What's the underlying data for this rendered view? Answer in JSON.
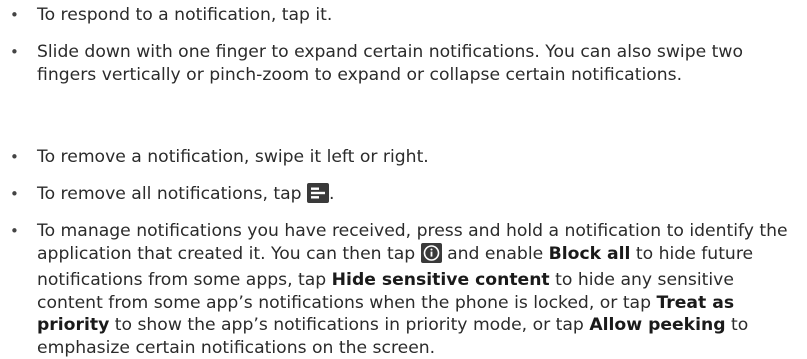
{
  "bullets": [
    {
      "text": "To respond to a notification, tap it."
    },
    {
      "text": "Slide down with one finger to expand certain notifications. You can also swipe two fingers vertically or pinch-zoom to expand or collapse certain notifications."
    },
    {
      "text": "To remove a notification, swipe it left or right."
    },
    {
      "before": "To remove all notifications, tap ",
      "icon": "clear-all-icon",
      "after": "."
    },
    {
      "p1": "To manage notifications you have received, press and hold a notification to identify the application that created it. You can then tap ",
      "icon": "info-icon",
      "p2": " and enable ",
      "b1": "Block all",
      "p3": " to hide future notifications from some apps, tap ",
      "b2": "Hide sensitive content",
      "p4": " to hide any sensitive content from some app’s notifications when the phone is locked, or tap ",
      "b3": "Treat as priority",
      "p5": " to show the app’s notifications in priority mode, or tap ",
      "b4": "Allow peeking",
      "p6": " to emphasize certain notifications on the screen."
    }
  ],
  "colors": {
    "text": "#2b2b2b",
    "icon_bg": "#3a3a3a",
    "icon_fg": "#ffffff"
  }
}
